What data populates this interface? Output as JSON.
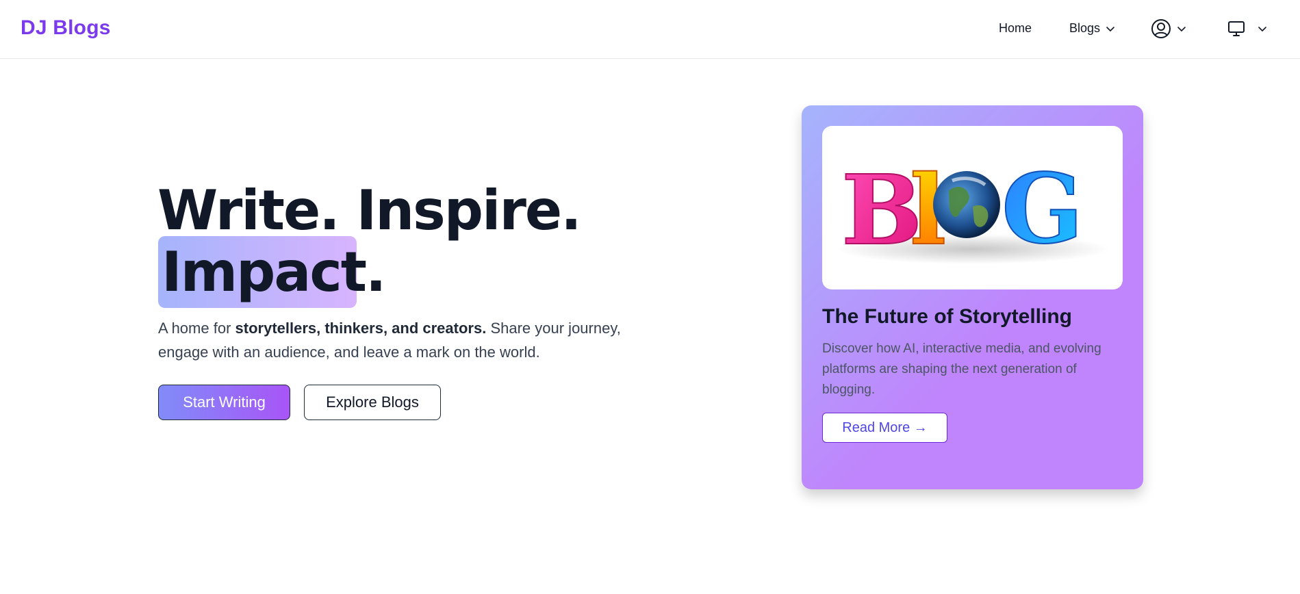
{
  "navbar": {
    "brand": "DJ Blogs",
    "links": [
      {
        "label": "Home"
      },
      {
        "label": "Blogs",
        "icon": "chevron-down-icon"
      }
    ],
    "user_menu": {
      "icon": "user-circle-icon",
      "dropdown_icon": "chevron-down-icon"
    },
    "theme_menu": {
      "icon": "monitor-icon",
      "dropdown_icon": "chevron-down-icon"
    }
  },
  "hero": {
    "title_line1": "Write. Inspire.",
    "title_line2": "Impact.",
    "desc_prefix": "A home for ",
    "desc_bold": "storytellers, thinkers, and creators.",
    "desc_suffix": " Share your journey, engage with an audience, and leave a mark on the world.",
    "primary_button": "Start Writing",
    "secondary_button": "Explore Blogs"
  },
  "card": {
    "image_alt": "BLOG",
    "title": "The Future of Storytelling",
    "description": "Discover how AI, interactive media, and evolving platforms are shaping the next generation of blogging.",
    "button": "Read More →"
  },
  "colors": {
    "brand": "#7c3aed",
    "text_dark": "#111827",
    "card_gradient_start": "#a5b4fc",
    "card_gradient_end": "#c084fc",
    "button_gradient_start": "#818cf8",
    "button_gradient_end": "#a855f7"
  }
}
